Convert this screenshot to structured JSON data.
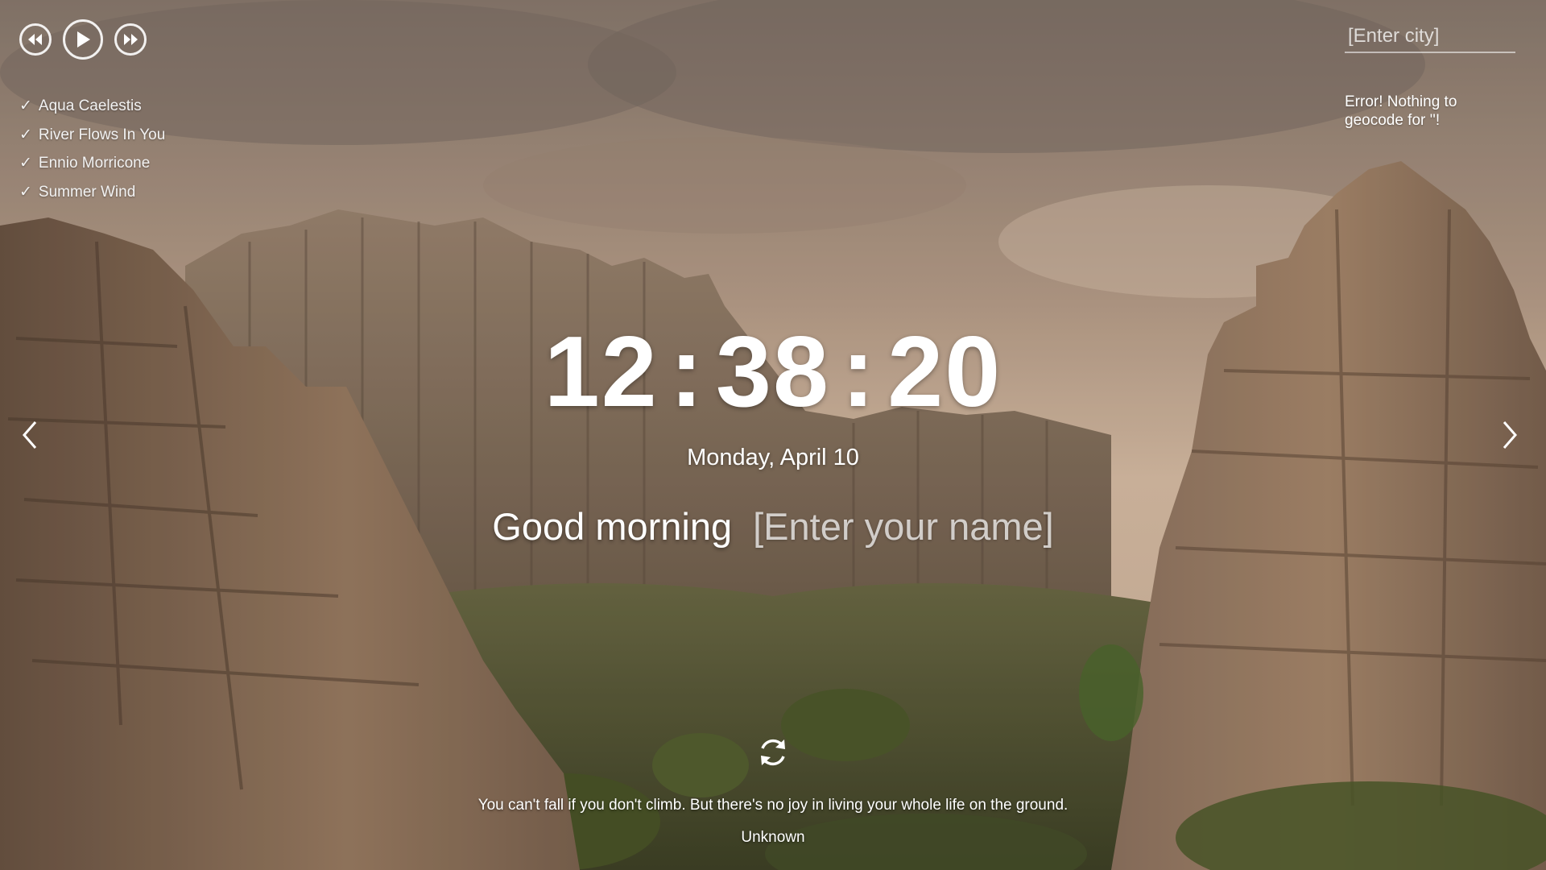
{
  "player": {
    "prev_icon": "rewind-icon",
    "play_icon": "play-icon",
    "next_icon": "fast-forward-icon"
  },
  "playlist": [
    {
      "title": "Aqua Caelestis",
      "check": "✓"
    },
    {
      "title": "River Flows In You",
      "check": "✓"
    },
    {
      "title": "Ennio Morricone",
      "check": "✓"
    },
    {
      "title": "Summer Wind",
      "check": "✓"
    }
  ],
  "weather": {
    "city_placeholder": "[Enter city]",
    "error_text": "Error! Nothing to geocode for ''!"
  },
  "clock": {
    "hours": "12",
    "minutes": "38",
    "seconds": "20",
    "separator": ":"
  },
  "date": "Monday, April 10",
  "greeting": {
    "text": "Good morning",
    "name_placeholder": "[Enter your name]"
  },
  "quote": {
    "text": "You can't fall if you don't climb. But there's no joy in living your whole life on the ground.",
    "author": "Unknown"
  },
  "icons": {
    "prev_slide": "chevron-left-icon",
    "next_slide": "chevron-right-icon",
    "refresh": "refresh-icon"
  },
  "colors": {
    "text": "#ffffff",
    "sky": "#c6ab95",
    "rock": "#8a6f58"
  }
}
